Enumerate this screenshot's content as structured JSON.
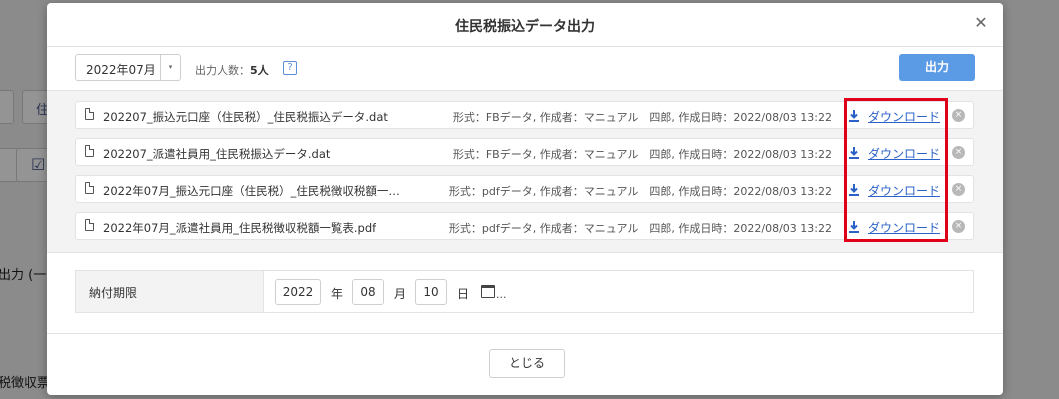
{
  "background": {
    "btn_partial_1": "住",
    "label_partial_1": "出力 (一般",
    "label_partial_2": "税徴収票"
  },
  "modal": {
    "title": "住民税振込データ出力",
    "close_glyph": "✕",
    "month_value": "2022年07月",
    "month_arrow": "▾",
    "count_label": "出力人数：",
    "count_value": "5人",
    "help_glyph": "?",
    "output_button": "出力",
    "files": [
      {
        "name": "202207_振込元口座（住民税）_住民税振込データ.dat",
        "meta": "形式：FBデータ, 作成者：マニュアル　四郎, 作成日時：2022/08/03 13:22",
        "download_label": "ダウンロード"
      },
      {
        "name": "202207_派遣社員用_住民税振込データ.dat",
        "meta": "形式：FBデータ, 作成者：マニュアル　四郎, 作成日時：2022/08/03 13:22",
        "download_label": "ダウンロード"
      },
      {
        "name": "2022年07月_振込元口座（住民税）_住民税徴収税額一…",
        "meta": "形式：pdfデータ, 作成者：マニュアル　四郎, 作成日時：2022/08/03 13:22",
        "download_label": "ダウンロード"
      },
      {
        "name": "2022年07月_派遣社員用_住民税徴収税額一覧表.pdf",
        "meta": "形式：pdfデータ, 作成者：マニュアル　四郎, 作成日時：2022/08/03 13:22",
        "download_label": "ダウンロード"
      }
    ],
    "delete_glyph": "×",
    "deadline": {
      "label": "納付期限",
      "year": "2022",
      "year_unit": "年",
      "month": "08",
      "month_unit": "月",
      "day": "10",
      "day_unit": "日",
      "ellipsis": "..."
    },
    "close_button": "とじる"
  },
  "colors": {
    "primary": "#5b9be6",
    "link": "#2b62c8",
    "highlight": "#e0001a"
  },
  "icons": {
    "file": "file-icon",
    "download": "download-icon",
    "delete": "delete-circle-icon",
    "calendar": "calendar-icon",
    "help": "help-icon",
    "close": "close-icon"
  }
}
